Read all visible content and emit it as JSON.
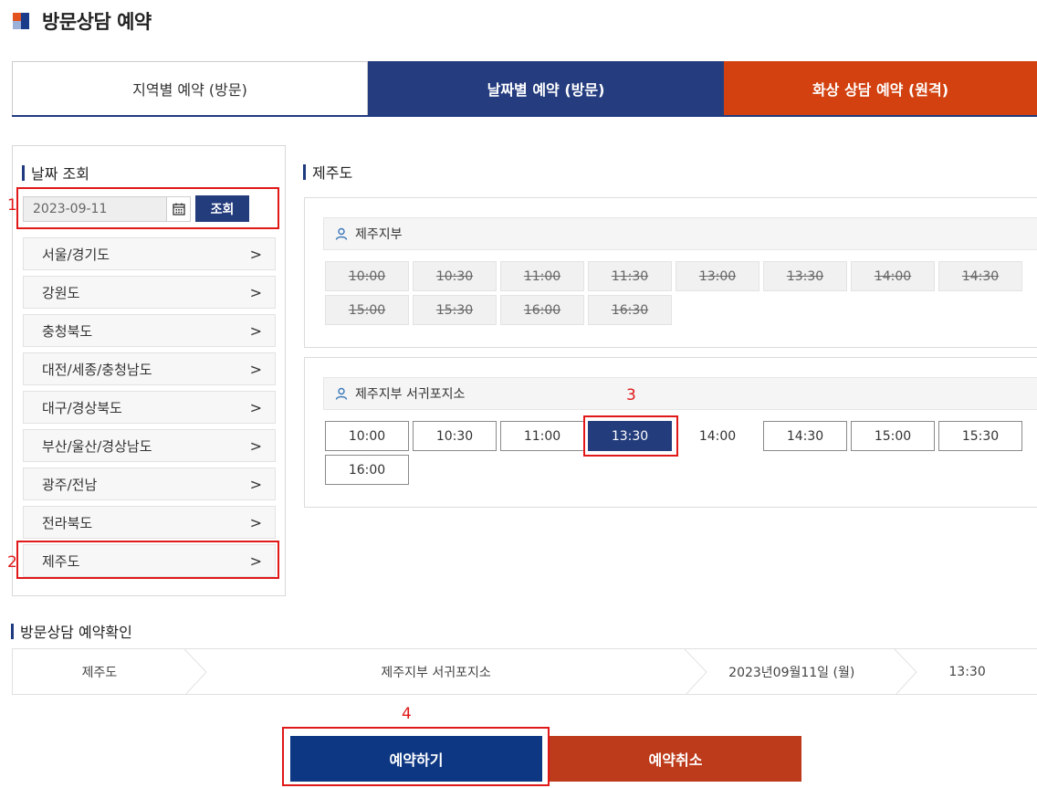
{
  "page": {
    "title": "방문상담 예약"
  },
  "tabs": [
    {
      "label": "지역별 예약 (방문)"
    },
    {
      "label": "날짜별 예약 (방문)"
    },
    {
      "label": "화상 상담 예약 (원격)"
    }
  ],
  "sidebar": {
    "heading": "날짜 조회",
    "date_value": "2023-09-11",
    "search_label": "조회",
    "regions": [
      {
        "label": "서울/경기도"
      },
      {
        "label": "강원도"
      },
      {
        "label": "충청북도"
      },
      {
        "label": "대전/세종/충청남도"
      },
      {
        "label": "대구/경상북도"
      },
      {
        "label": "부산/울산/경상남도"
      },
      {
        "label": "광주/전남"
      },
      {
        "label": "전라북도"
      },
      {
        "label": "제주도"
      }
    ]
  },
  "main": {
    "region_heading": "제주도",
    "offices": [
      {
        "name": "제주지부",
        "slots": [
          "10:00",
          "10:30",
          "11:00",
          "11:30",
          "13:00",
          "13:30",
          "14:00",
          "14:30",
          "15:00",
          "15:30",
          "16:00",
          "16:30"
        ]
      },
      {
        "name": "제주지부 서귀포지소",
        "slots": [
          "10:00",
          "10:30",
          "11:00",
          "13:30",
          "14:00",
          "14:30",
          "15:00",
          "15:30",
          "16:00"
        ]
      }
    ]
  },
  "confirm": {
    "heading": "방문상담 예약확인",
    "region": "제주도",
    "office": "제주지부 서귀포지소",
    "date": "2023년09월11일 (월)",
    "time": "13:30"
  },
  "actions": {
    "reserve_label": "예약하기",
    "cancel_label": "예약취소"
  },
  "annotations": {
    "a1": "1",
    "a2": "2",
    "a3": "3",
    "a4": "4"
  },
  "colors": {
    "navy": "#233c7c",
    "orange": "#d2410f",
    "highlight": "#e01818"
  }
}
